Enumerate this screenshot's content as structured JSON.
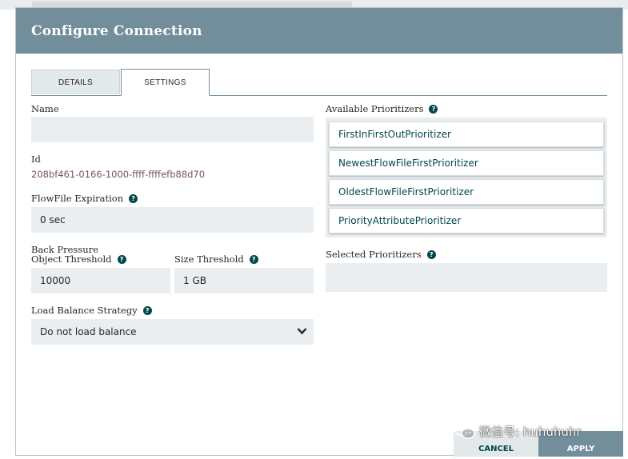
{
  "dialog": {
    "title": "Configure Connection",
    "tabs": [
      {
        "label": "DETAILS"
      },
      {
        "label": "SETTINGS",
        "active": true
      }
    ]
  },
  "settings": {
    "name": {
      "label": "Name",
      "value": ""
    },
    "id": {
      "label": "Id",
      "value": "208bf461-0166-1000-ffff-ffffefb88d70"
    },
    "flowfile_expiration": {
      "label": "FlowFile Expiration",
      "value": "0 sec"
    },
    "back_pressure": {
      "label": "Back Pressure",
      "object_threshold": {
        "label": "Object Threshold",
        "value": "10000"
      },
      "size_threshold": {
        "label": "Size Threshold",
        "value": "1 GB"
      }
    },
    "load_balance": {
      "label": "Load Balance Strategy",
      "value": "Do not load balance"
    }
  },
  "prioritizers": {
    "available_label": "Available Prioritizers",
    "available": [
      "FirstInFirstOutPrioritizer",
      "NewestFlowFileFirstPrioritizer",
      "OldestFlowFileFirstPrioritizer",
      "PriorityAttributePrioritizer"
    ],
    "selected_label": "Selected Prioritizers"
  },
  "buttons": {
    "cancel": "CANCEL",
    "apply": "APPLY"
  },
  "watermark": {
    "text": "微信号: huhuhuhr"
  },
  "icons": {
    "help": "help-circle-icon",
    "chevron": "chevron-down-icon",
    "wechat": "wechat-icon"
  },
  "colors": {
    "header": "#728e9b",
    "accent": "#004849",
    "field_bg": "#eaeef0",
    "id_text": "#775351"
  }
}
